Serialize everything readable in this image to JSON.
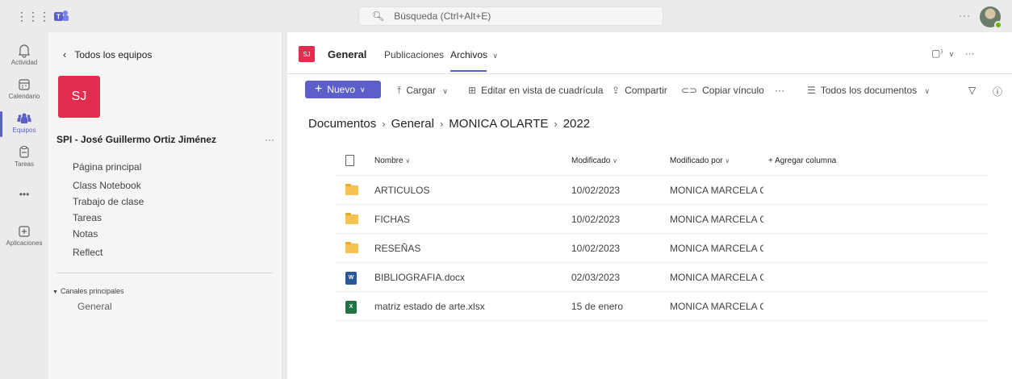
{
  "topbar": {
    "search_placeholder": "Búsqueda (Ctrl+Alt+E)",
    "more": "···"
  },
  "rail": [
    {
      "label": "Actividad",
      "icon": "bell-icon"
    },
    {
      "label": "Calendario",
      "icon": "calendar-icon"
    },
    {
      "label": "Equipos",
      "icon": "teams-icon"
    },
    {
      "label": "Tareas",
      "icon": "tasks-icon"
    },
    {
      "label": "",
      "icon": "more-icon"
    },
    {
      "label": "Aplicaciones",
      "icon": "apps-icon"
    }
  ],
  "team_panel": {
    "back_label": "Todos los equipos",
    "team_initials": "SJ",
    "team_name": "SPI - José Guillermo Ortiz Jiménez",
    "more": "···",
    "nav": [
      "Página principal",
      "Class Notebook",
      "Trabajo de clase",
      "Tareas",
      "Notas",
      "Reflect"
    ],
    "channels_title": "Canales principales",
    "channels": [
      "General"
    ]
  },
  "channel_header": {
    "initials": "SJ",
    "name": "General",
    "tabs": [
      "Publicaciones",
      "Archivos"
    ],
    "active_tab": "Archivos",
    "actions": "▢ ⌄  ···"
  },
  "toolbar": {
    "new_label": "Nuevo",
    "upload": "Cargar",
    "edit_grid": "Editar en vista de cuadrícula",
    "share": "Compartir",
    "copy_link": "Copiar vínculo",
    "more": "···",
    "view": "Todos los documentos"
  },
  "breadcrumb": [
    "Documentos",
    "General",
    "MONICA OLARTE",
    "2022"
  ],
  "table": {
    "headers": {
      "name": "Nombre",
      "modified": "Modificado",
      "modified_by": "Modificado por",
      "add_column": "+ Agregar columna"
    },
    "rows": [
      {
        "type": "folder",
        "name": "ARTICULOS",
        "modified": "10/02/2023",
        "modified_by": "MONICA MARCELA CA"
      },
      {
        "type": "folder",
        "name": "FICHAS",
        "modified": "10/02/2023",
        "modified_by": "MONICA MARCELA CA"
      },
      {
        "type": "folder",
        "name": "RESEÑAS",
        "modified": "10/02/2023",
        "modified_by": "MONICA MARCELA CA"
      },
      {
        "type": "word",
        "name": "BIBLIOGRAFIA.docx",
        "modified": "02/03/2023",
        "modified_by": "MONICA MARCELA CA"
      },
      {
        "type": "excel",
        "name": "matriz estado de arte.xlsx",
        "modified": "15 de enero",
        "modified_by": "MONICA MARCELA CA"
      }
    ]
  },
  "colors": {
    "accent": "#5b5fc7",
    "team_tile": "#e22d4f",
    "folder": "#f4c350",
    "word": "#2b579a",
    "excel": "#217346"
  }
}
